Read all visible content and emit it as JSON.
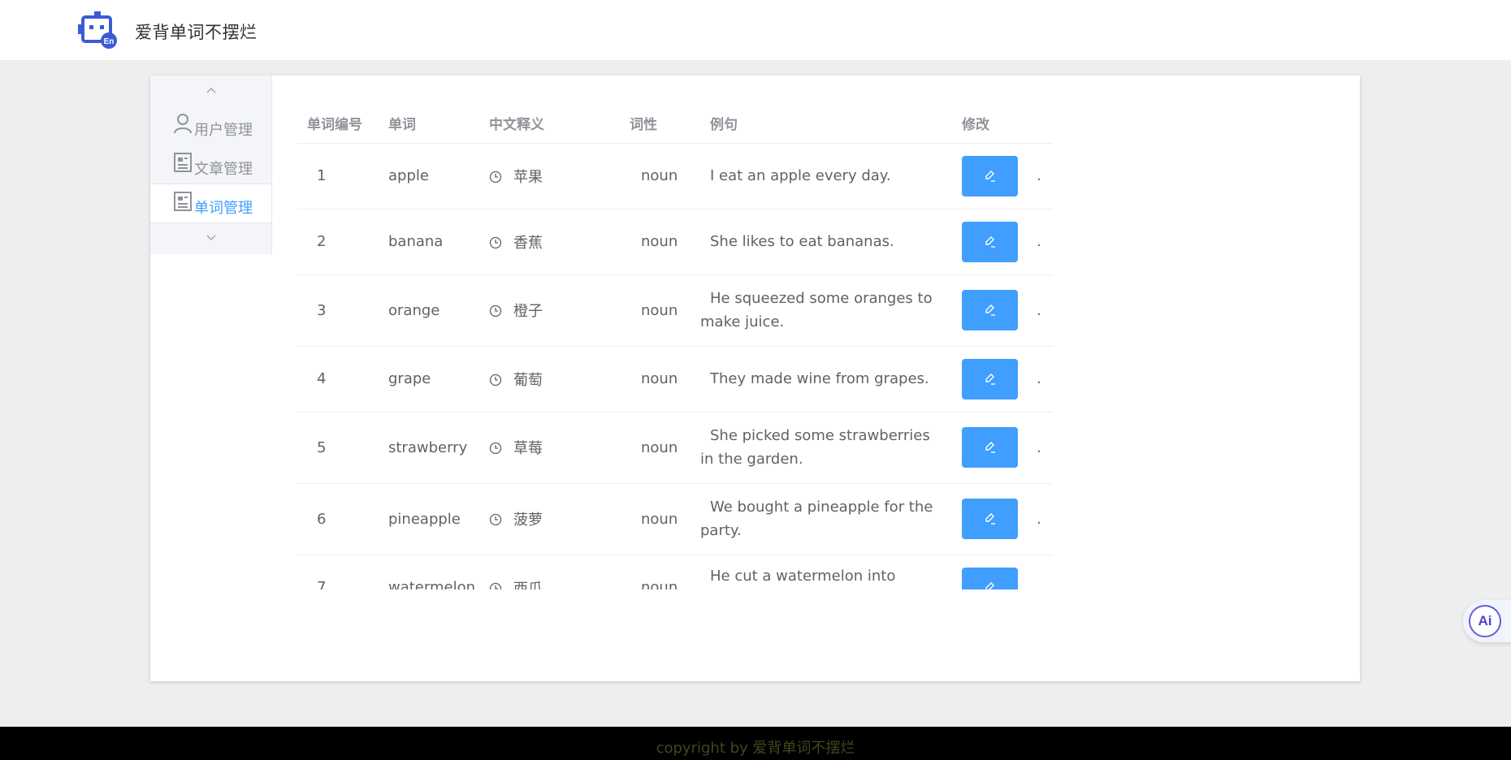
{
  "header": {
    "app_title": "爱背单词不摆烂",
    "logo_icon": "robot-en-icon"
  },
  "sidebar": {
    "items": [
      {
        "label": "用户管理",
        "icon": "user-icon",
        "active": false
      },
      {
        "label": "文章管理",
        "icon": "document-icon",
        "active": false
      },
      {
        "label": "单词管理",
        "icon": "document-icon",
        "active": true
      }
    ]
  },
  "table": {
    "columns": [
      "单词编号",
      "单词",
      "中文释义",
      "词性",
      "例句",
      "修改"
    ],
    "rows": [
      {
        "id": "1",
        "word": "apple",
        "meaning": "苹果",
        "pos": "noun",
        "example": "I eat an apple every day."
      },
      {
        "id": "2",
        "word": "banana",
        "meaning": "香蕉",
        "pos": "noun",
        "example": "She likes to eat bananas."
      },
      {
        "id": "3",
        "word": "orange",
        "meaning": "橙子",
        "pos": "noun",
        "example": "He squeezed some oranges to make juice."
      },
      {
        "id": "4",
        "word": "grape",
        "meaning": "葡萄",
        "pos": "noun",
        "example": "They made wine from grapes."
      },
      {
        "id": "5",
        "word": "strawberry",
        "meaning": "草莓",
        "pos": "noun",
        "example": "She picked some strawberries in the garden."
      },
      {
        "id": "6",
        "word": "pineapple",
        "meaning": "菠萝",
        "pos": "noun",
        "example": "We bought a pineapple for the party."
      },
      {
        "id": "7",
        "word": "watermelon",
        "meaning": "西瓜",
        "pos": "noun",
        "example": "He cut a watermelon into slices."
      }
    ],
    "trailing_mark": "."
  },
  "ai_badge": {
    "label": "Ai"
  },
  "footer": {
    "copyright": "copyright by 爱背单词不摆烂"
  },
  "colors": {
    "accent": "#409eff",
    "footer_bg": "#000000",
    "page_bg": "#eeeeee"
  }
}
